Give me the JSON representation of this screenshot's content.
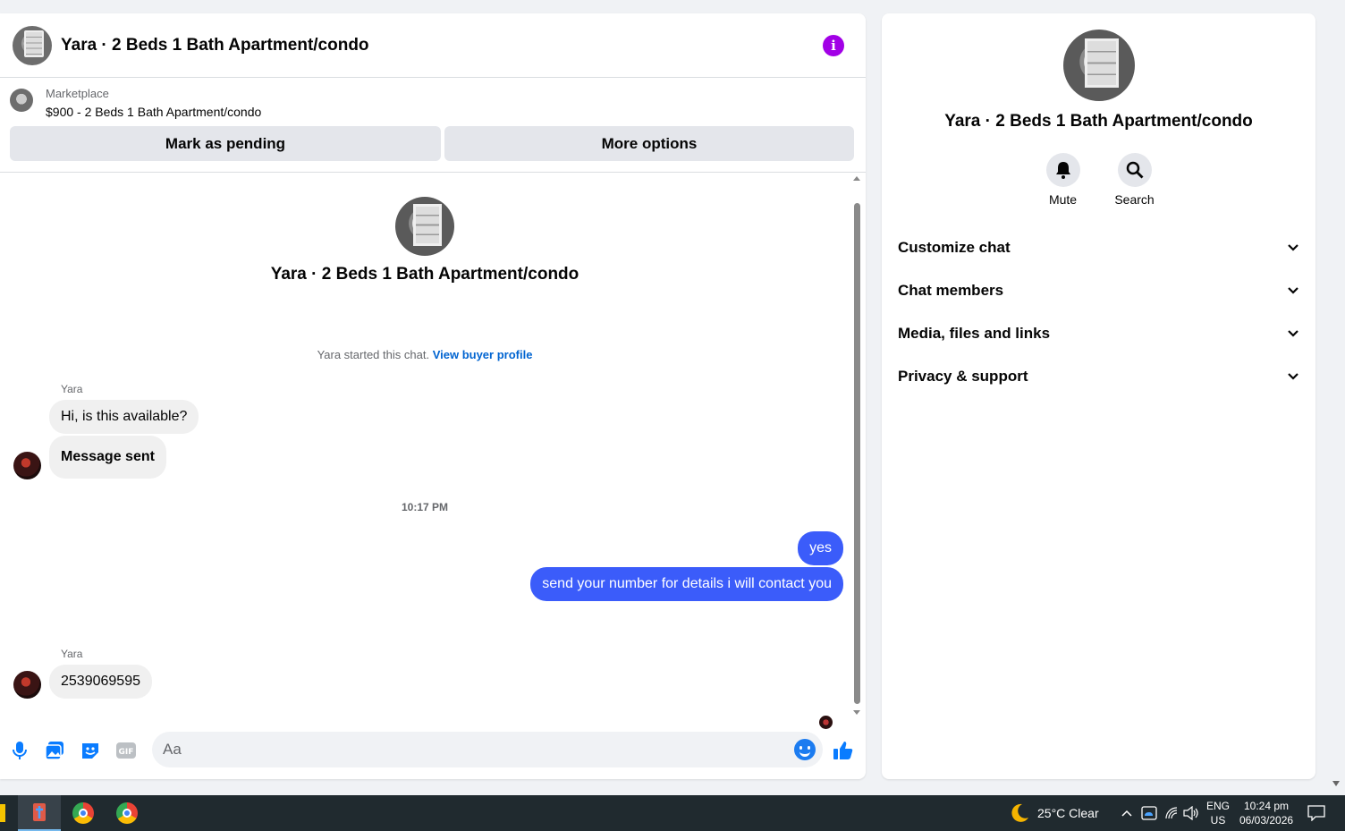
{
  "chat": {
    "title": "Yara · 2 Beds 1 Bath Apartment/condo",
    "marketplace_label": "Marketplace",
    "listing": "$900 - 2 Beds 1 Bath Apartment/condo",
    "mark_pending": "Mark as pending",
    "more_options": "More options",
    "profile_name": "Yara · 2 Beds 1 Bath Apartment/condo",
    "started_text": "Yara started this chat.",
    "view_profile": "View buyer profile",
    "messages": [
      {
        "sender": "Yara",
        "text": "Hi, is this available?"
      },
      {
        "text": "Message sent"
      },
      {
        "timestamp": "10:17 PM"
      },
      {
        "outgoing": true,
        "text": "yes"
      },
      {
        "outgoing": true,
        "text": "send your number for details i will contact you"
      },
      {
        "sender": "Yara",
        "text": "2539069595"
      }
    ],
    "composer_placeholder": "Aa"
  },
  "side": {
    "name": "Yara · 2 Beds 1 Bath Apartment/condo",
    "mute": "Mute",
    "search": "Search",
    "menu": [
      "Customize chat",
      "Chat members",
      "Media, files and links",
      "Privacy & support"
    ]
  },
  "taskbar": {
    "weather": "25°C  Clear",
    "lang": "ENG",
    "region": "US",
    "time": "10:24 pm",
    "date": "06/03/2026"
  },
  "colors": {
    "accent": "#3b5cfa",
    "info": "#a200e6",
    "icon_blue": "#0a7cff"
  }
}
